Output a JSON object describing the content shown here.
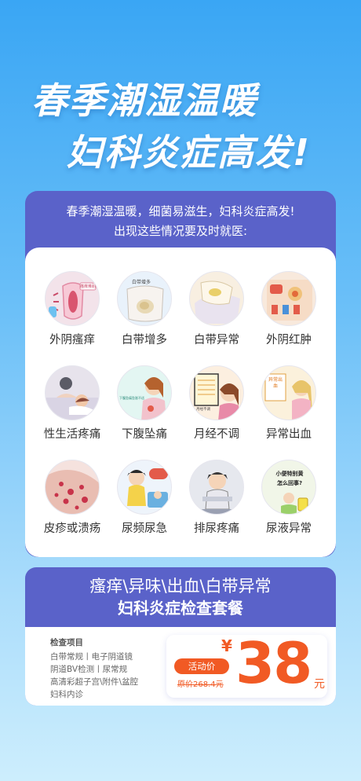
{
  "hero": {
    "line1": "春季潮湿温暖",
    "line2": "妇科炎症高发!"
  },
  "intro": {
    "line1": "春季潮湿温暖，细菌易滋生，妇科炎症高发!",
    "line2": "出现这些情况要及时就医:"
  },
  "symptoms": [
    {
      "label": "外阴瘙痒",
      "icon": "itch-icon",
      "bg": "#f3e3ea"
    },
    {
      "label": "白带增多",
      "icon": "discharge-icon",
      "bg": "#e9f2fb"
    },
    {
      "label": "白带异常",
      "icon": "abnormal-discharge-icon",
      "bg": "#f8efe1"
    },
    {
      "label": "外阴红肿",
      "icon": "swelling-icon",
      "bg": "#f8e9dc"
    },
    {
      "label": "性生活疼痛",
      "icon": "couple-pain-icon",
      "bg": "#e7e3ec"
    },
    {
      "label": "下腹坠痛",
      "icon": "abdomen-pain-icon",
      "bg": "#e3f6f2"
    },
    {
      "label": "月经不调",
      "icon": "calendar-icon",
      "bg": "#fcefe0"
    },
    {
      "label": "异常出血",
      "icon": "bleeding-icon",
      "bg": "#fbf1dc"
    },
    {
      "label": "皮疹或溃疡",
      "icon": "rash-icon",
      "bg": "#f5e2de"
    },
    {
      "label": "尿频尿急",
      "icon": "urgency-icon",
      "bg": "#eef4fb"
    },
    {
      "label": "排尿疼痛",
      "icon": "urination-pain-icon",
      "bg": "#e6e8ee"
    },
    {
      "label": "尿液异常",
      "icon": "urine-abnormal-icon",
      "bg": "#f1f6e8"
    }
  ],
  "symptom_texts": {
    "s0": "瘙痒难耐",
    "s1": "白带增多",
    "s4": "",
    "s5": "下腹坠痛坠胀不适",
    "s6": "月经不调",
    "s7": "异常出血",
    "s9": "",
    "s11a": "小便特别黄",
    "s11b": "怎么回事?"
  },
  "package": {
    "title1": "瘙痒\\异味\\出血\\白带异常",
    "title2": "妇科炎症检查套餐",
    "items_title": "检查项目",
    "items": [
      "白带常规丨电子阴道镜",
      "阴道BV检测丨尿常规",
      "高清彩超子宫\\附件\\盆腔",
      "妇科内诊"
    ],
    "badge": "活动价",
    "original_price": "原价268.4元",
    "currency": "¥",
    "price": "38",
    "unit": "元"
  },
  "colors": {
    "accent": "#5a62c9",
    "price": "#f15a24",
    "bg_top": "#3aa6f4",
    "bg_bottom": "#cdeefd"
  }
}
